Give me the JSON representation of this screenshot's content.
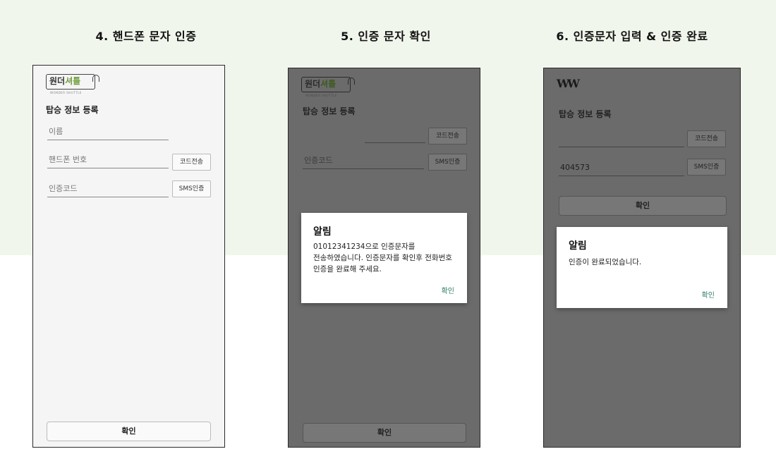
{
  "colors": {
    "band_bg": "#f1f6ec",
    "screen_light": "#f5f5f5",
    "screen_dimmed": "#6b6b6b",
    "accent_logo_green": "#6f9e3b",
    "dialog_ok_teal": "#2e7d6a"
  },
  "steps": [
    {
      "title": "4. 핸드폰 문자 인증",
      "logo": {
        "text_a": "원더",
        "text_b": "셔틀",
        "sub": "WONDER SHUTTLE"
      },
      "heading": "탑승 정보 등록",
      "name_placeholder": "이름",
      "phone_placeholder": "핸드폰 번호",
      "code_send": "코드전송",
      "code_placeholder": "인증코드",
      "sms_verify": "SMS인증",
      "confirm": "확인"
    },
    {
      "title": "5. 인증 문자 확인",
      "logo": {
        "text_a": "원더",
        "text_b": "셔틀",
        "sub": "WONDER SHUTTLE"
      },
      "heading": "탑승 정보 등록",
      "code_send": "코드전송",
      "code_placeholder": "인증코드",
      "sms_verify": "SMS인증",
      "confirm": "확인",
      "dialog": {
        "title": "알림",
        "line1": "01012341234으로 인증문자를",
        "line2": "전송하였습니다. 인증문자를 확인후 전화번호",
        "line3": "인증을 완료해 주세요.",
        "ok": "확인"
      }
    },
    {
      "title": "6. 인증문자 입력 & 인증 완료",
      "logo_text": "W",
      "heading": "탑승 정보 등록",
      "code_send": "코드전송",
      "code_value": "404573",
      "sms_verify": "SMS인증",
      "confirm": "확인",
      "dialog": {
        "title": "알림",
        "message": "인증이 완료되었습니다.",
        "ok": "확인"
      }
    }
  ]
}
